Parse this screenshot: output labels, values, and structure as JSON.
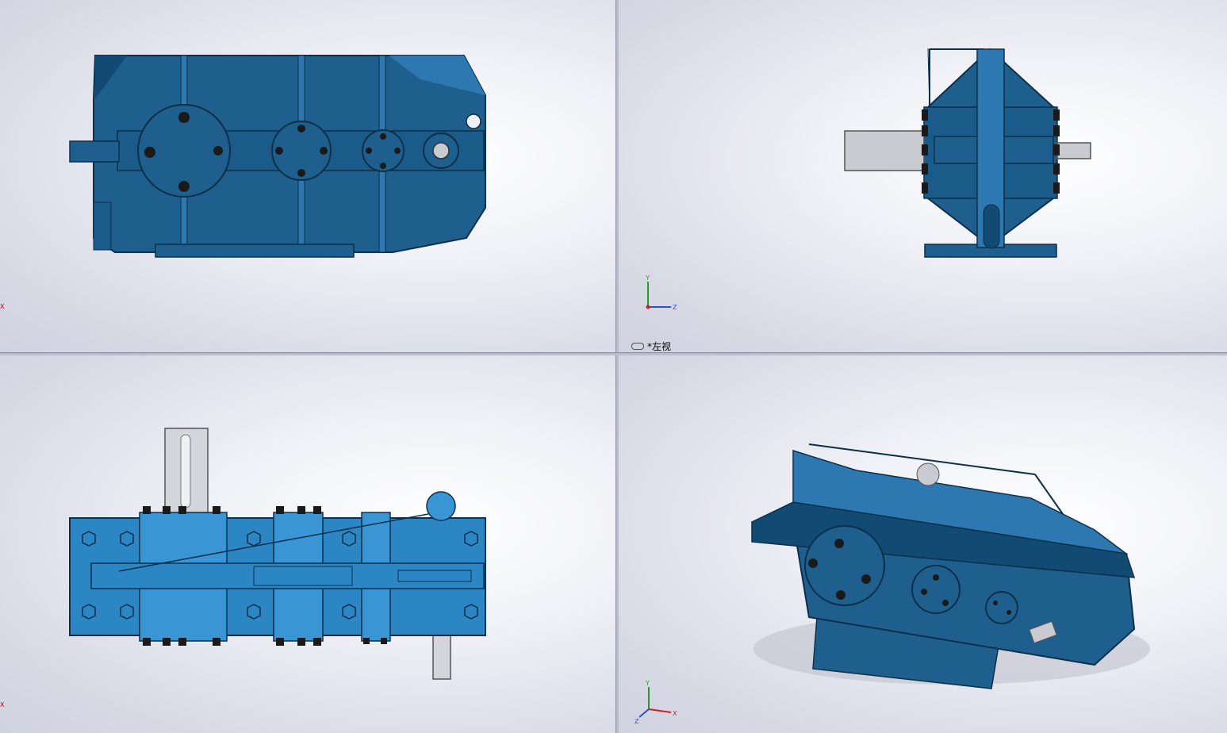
{
  "viewports": {
    "top_right": {
      "view_label": "*左视",
      "triad": {
        "y": "Y",
        "z": "Z"
      }
    },
    "bottom_right": {
      "triad": {
        "x": "X",
        "y": "Y",
        "z": "Z"
      }
    },
    "top_left": {
      "axis_marker": "X"
    },
    "bottom_left": {
      "axis_marker": "X"
    }
  },
  "colors": {
    "body": "#1f5f8e",
    "body_dark": "#114a72",
    "body_light": "#2d78b0",
    "shaft": "#c9cbd0",
    "bolt": "#1a1a1a",
    "background": "#eef0f6"
  },
  "model": "gear-reducer-housing"
}
